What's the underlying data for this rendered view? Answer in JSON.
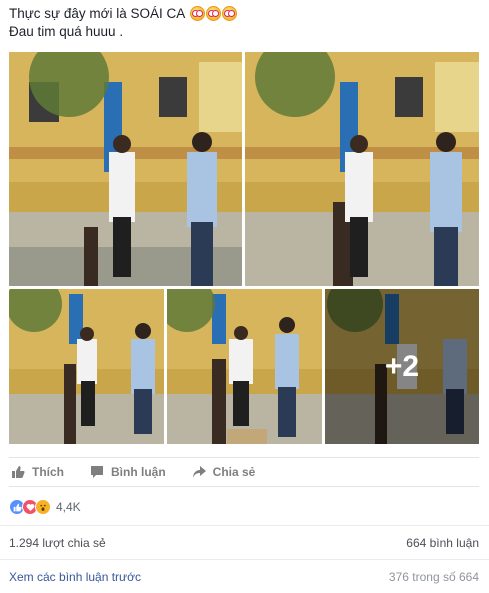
{
  "post": {
    "line1": "Thực sự đây mới là SOÁI CA",
    "line2": "Đau tim quá huuu ."
  },
  "photos": {
    "more_overlay": "+2"
  },
  "actions": {
    "like": "Thích",
    "comment": "Bình luận",
    "share": "Chia sẻ"
  },
  "reactions": {
    "count": "4,4K",
    "types": [
      "like-icon",
      "love-icon",
      "wow-icon"
    ]
  },
  "stats": {
    "shares": "1.294 lượt chia sẻ",
    "comments": "664 bình luận"
  },
  "comments": {
    "view_previous": "Xem các bình luận trước",
    "progress": "376 trong số 664"
  },
  "colors": {
    "accent_blue": "#365899",
    "like_blue": "#5890ff",
    "love_red": "#f25268",
    "wow_yellow": "#f7b125"
  }
}
